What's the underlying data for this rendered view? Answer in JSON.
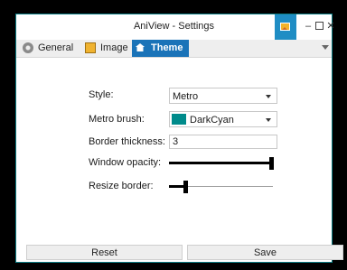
{
  "window": {
    "title": "AniView - Settings"
  },
  "tabs": [
    {
      "label": "General",
      "icon": "gear-icon",
      "active": false
    },
    {
      "label": "Image",
      "icon": "image-icon",
      "active": false
    },
    {
      "label": "Theme",
      "icon": "theme-icon",
      "active": true
    }
  ],
  "theme": {
    "style_label": "Style:",
    "style_value": "Metro",
    "brush_label": "Metro brush:",
    "brush_value": "DarkCyan",
    "brush_color": "#008B8B",
    "border_label": "Border thickness:",
    "border_value": "3",
    "opacity_label": "Window opacity:",
    "opacity_level": 1.0,
    "resize_label": "Resize border:",
    "resize_level": 0.15
  },
  "buttons": {
    "reset": "Reset",
    "save": "Save"
  },
  "colors": {
    "accent": "#1A73B8",
    "window_border": "#0C7C84",
    "title_icon_bg": "#1F8DC4"
  }
}
